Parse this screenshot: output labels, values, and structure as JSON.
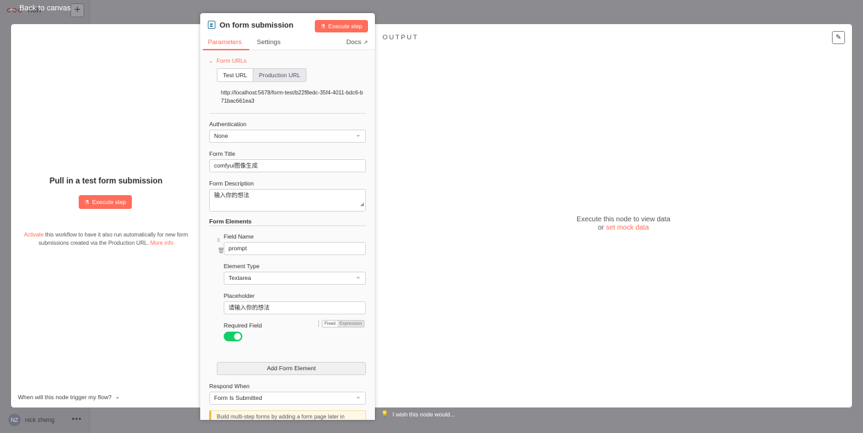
{
  "background": {
    "logo_text": "n8n",
    "plus_label": "+",
    "user_initials": "NZ",
    "user_name": "nick zheng",
    "more_label": "•••"
  },
  "back_label": "Back to canvas",
  "input_panel": {
    "title": "Pull in a test form submission",
    "execute_label": "Execute step",
    "desc_activate": "Activate",
    "desc_body": " this workflow to have it also run automatically for new form submissions created via the Production URL. ",
    "desc_more": "More info",
    "faq_label": "When will this node trigger my flow?"
  },
  "node": {
    "title": "On form submission",
    "execute_label": "Execute step",
    "tabs": {
      "parameters": "Parameters",
      "settings": "Settings",
      "docs": "Docs"
    },
    "form_urls": {
      "toggle_label": "Form URLs",
      "test_tab": "Test URL",
      "prod_tab": "Production URL",
      "url": "http://localhost:5678/form-test/b22f8edc-35f4-4011-bdc6-b71bac661ea3"
    },
    "authentication": {
      "label": "Authentication",
      "value": "None"
    },
    "form_title": {
      "label": "Form Title",
      "value": "comfyui图像生成"
    },
    "form_description": {
      "label": "Form Description",
      "value": "输入你的想法"
    },
    "form_elements": {
      "title": "Form Elements",
      "field_name_label": "Field Name",
      "field_name_value": "prompt",
      "element_type_label": "Element Type",
      "element_type_value": "Textarea",
      "placeholder_label": "Placeholder",
      "placeholder_value": "请输入你的想法",
      "required_label": "Required Field",
      "required_on": true,
      "fixed_label": "Fixed",
      "expression_label": "Expression"
    },
    "add_element_label": "Add Form Element",
    "respond_when": {
      "label": "Respond When",
      "value": "Form Is Submitted"
    },
    "notice": "Build multi-step forms by adding a form page later in"
  },
  "output": {
    "label": "OUTPUT",
    "empty_line1": "Execute this node to view data",
    "empty_or": "or ",
    "empty_link": "set mock data"
  },
  "feedback_label": "I wish this node would..."
}
